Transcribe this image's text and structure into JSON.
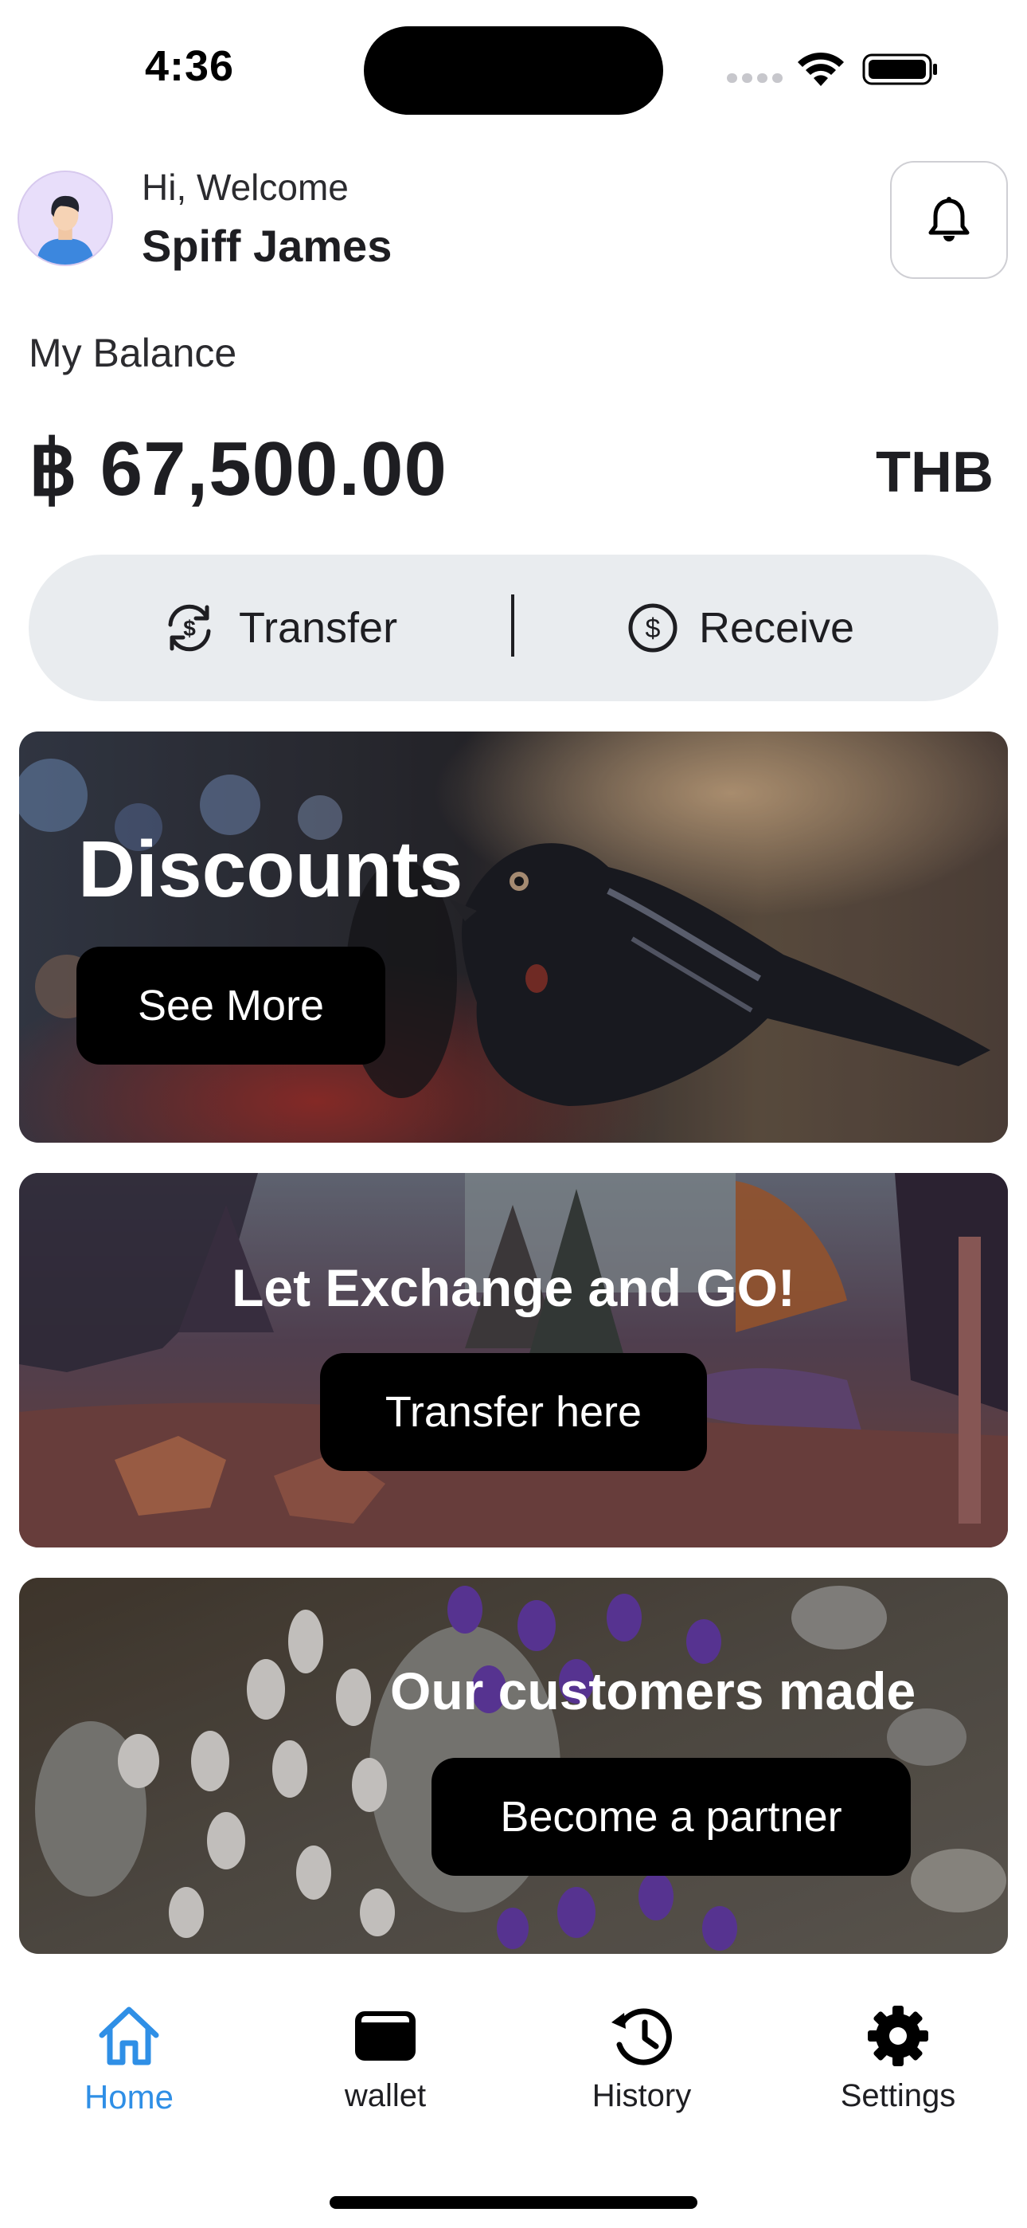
{
  "status_bar": {
    "time": "4:36"
  },
  "header": {
    "greeting": "Hi, Welcome",
    "user_name": "Spiff James"
  },
  "balance": {
    "label": "My Balance",
    "amount": "฿ 67,500.00",
    "currency": "THB"
  },
  "actions": {
    "transfer_label": "Transfer",
    "receive_label": "Receive"
  },
  "cards": [
    {
      "title": "Discounts",
      "button_label": "See More"
    },
    {
      "title": "Let Exchange and GO!",
      "button_label": "Transfer here"
    },
    {
      "title": "Our customers made",
      "button_label": "Become a partner"
    }
  ],
  "bottom_nav": {
    "items": [
      {
        "label": "Home",
        "icon": "home-icon",
        "active": true
      },
      {
        "label": "wallet",
        "icon": "wallet-icon",
        "active": false
      },
      {
        "label": "History",
        "icon": "history-icon",
        "active": false
      },
      {
        "label": "Settings",
        "icon": "gear-icon",
        "active": false
      }
    ]
  },
  "colors": {
    "accent": "#2f8fe6",
    "pill_background": "#e9ecef",
    "button_background": "#000000"
  }
}
